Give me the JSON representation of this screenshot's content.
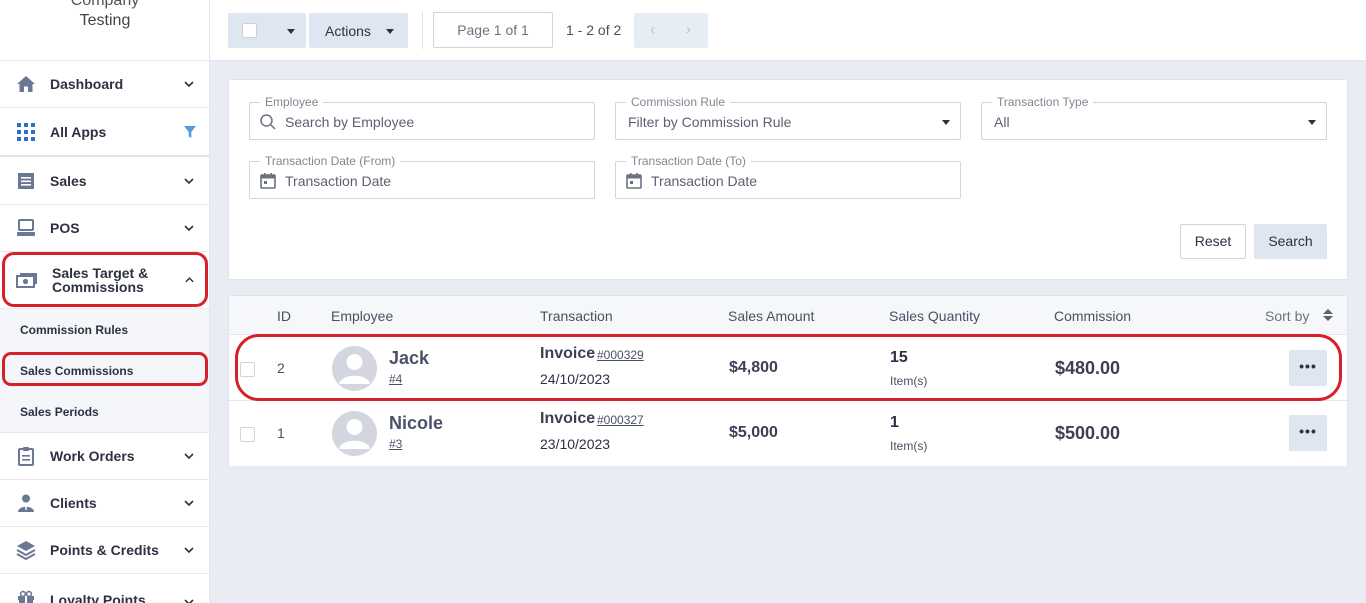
{
  "brand": {
    "partial_top": "Company",
    "name": "Testing"
  },
  "sidebar": {
    "items": [
      {
        "label": "Dashboard",
        "icon": "home-icon"
      },
      {
        "label": "All Apps",
        "icon": "grid-icon"
      },
      {
        "label": "Sales",
        "icon": "receipt-icon"
      },
      {
        "label": "POS",
        "icon": "monitor-icon"
      },
      {
        "label": "Sales Target & Commissions",
        "icon": "money-icon"
      },
      {
        "label": "Work Orders",
        "icon": "clipboard-icon"
      },
      {
        "label": "Clients",
        "icon": "person-icon"
      },
      {
        "label": "Points & Credits",
        "icon": "layers-icon"
      },
      {
        "label": "Loyalty Points",
        "icon": "gift-icon"
      }
    ],
    "subitems": [
      "Commission Rules",
      "Sales Commissions",
      "Sales Periods"
    ]
  },
  "toolbar": {
    "actions_label": "Actions",
    "page_label": "Page 1 of 1",
    "range_label": "1 - 2 of 2",
    "prev": "‹",
    "next": "›"
  },
  "filters": {
    "employee": {
      "label": "Employee",
      "placeholder": "Search by Employee"
    },
    "commission_rule": {
      "label": "Commission Rule",
      "placeholder": "Filter by Commission Rule"
    },
    "transaction_type": {
      "label": "Transaction Type",
      "value": "All"
    },
    "date_from": {
      "label": "Transaction Date (From)",
      "placeholder": "Transaction Date"
    },
    "date_to": {
      "label": "Transaction Date (To)",
      "placeholder": "Transaction Date"
    },
    "reset_label": "Reset",
    "search_label": "Search"
  },
  "table": {
    "headers": [
      "ID",
      "Employee",
      "Transaction",
      "Sales Amount",
      "Sales Quantity",
      "Commission",
      "Sort by"
    ],
    "rows": [
      {
        "id": "2",
        "employee": "Jack",
        "employee_ref": "#4",
        "transaction_type": "Invoice",
        "transaction_ref": "#000329",
        "date": "24/10/2023",
        "amount": "$4,800",
        "quantity": "15",
        "quantity_unit": "Item(s)",
        "commission": "$480.00",
        "more": "•••"
      },
      {
        "id": "1",
        "employee": "Nicole",
        "employee_ref": "#3",
        "transaction_type": "Invoice",
        "transaction_ref": "#000327",
        "date": "23/10/2023",
        "amount": "$5,000",
        "quantity": "1",
        "quantity_unit": "Item(s)",
        "commission": "$500.00",
        "more": "•••"
      }
    ]
  },
  "colors": {
    "accent": "#5a8fd0",
    "highlight": "#d6202a",
    "button_bg": "#dde6f1",
    "icon": "#5a6b8c"
  }
}
